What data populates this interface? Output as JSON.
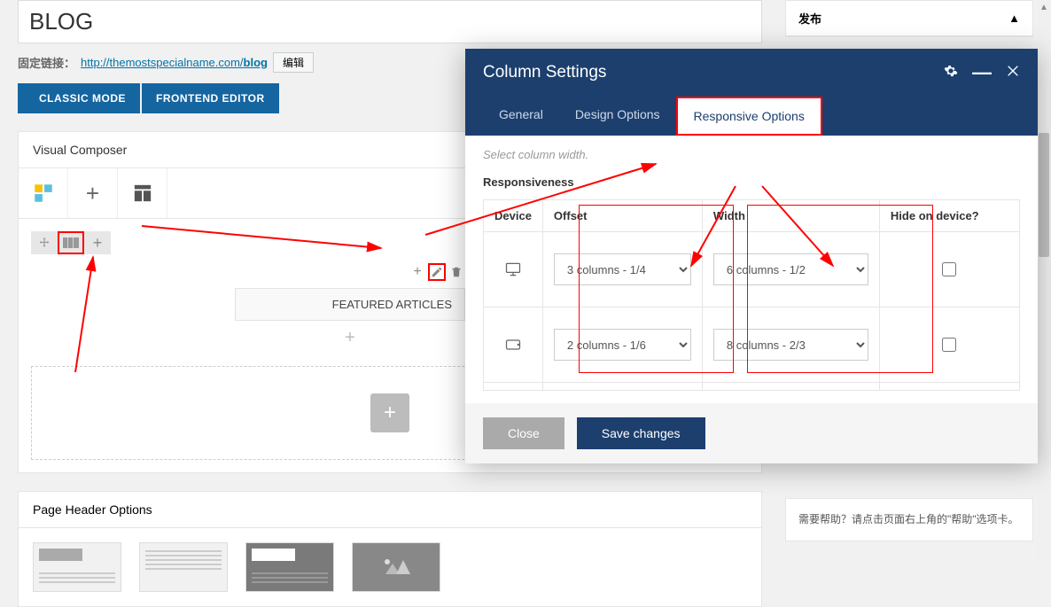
{
  "page": {
    "title": "BLOG",
    "permalink_label": "固定链接：",
    "permalink_base": "http://themostspecialname.com/",
    "permalink_slug": "blog",
    "edit_slug": "编辑"
  },
  "mode_buttons": {
    "classic": "CLASSIC MODE",
    "frontend": "FRONTEND EDITOR"
  },
  "vc": {
    "panel_title": "Visual Composer",
    "text_block": "FEATURED ARTICLES"
  },
  "pho": {
    "title": "Page Header Options"
  },
  "sidebar": {
    "publish_title": "发布",
    "help_text": "需要帮助？请点击页面右上角的\"帮助\"选项卡。"
  },
  "modal": {
    "title": "Column Settings",
    "tabs": {
      "general": "General",
      "design": "Design Options",
      "responsive": "Responsive Options"
    },
    "hint": "Select column width.",
    "section": "Responsiveness",
    "cols": {
      "device": "Device",
      "offset": "Offset",
      "width": "Width",
      "hide": "Hide on device?"
    },
    "rows": [
      {
        "offset": "3 columns - 1/4",
        "width": "6 columns - 1/2"
      },
      {
        "offset": "2 columns - 1/6",
        "width": "8 columns - 2/3"
      }
    ],
    "footer": {
      "close": "Close",
      "save": "Save changes"
    }
  }
}
